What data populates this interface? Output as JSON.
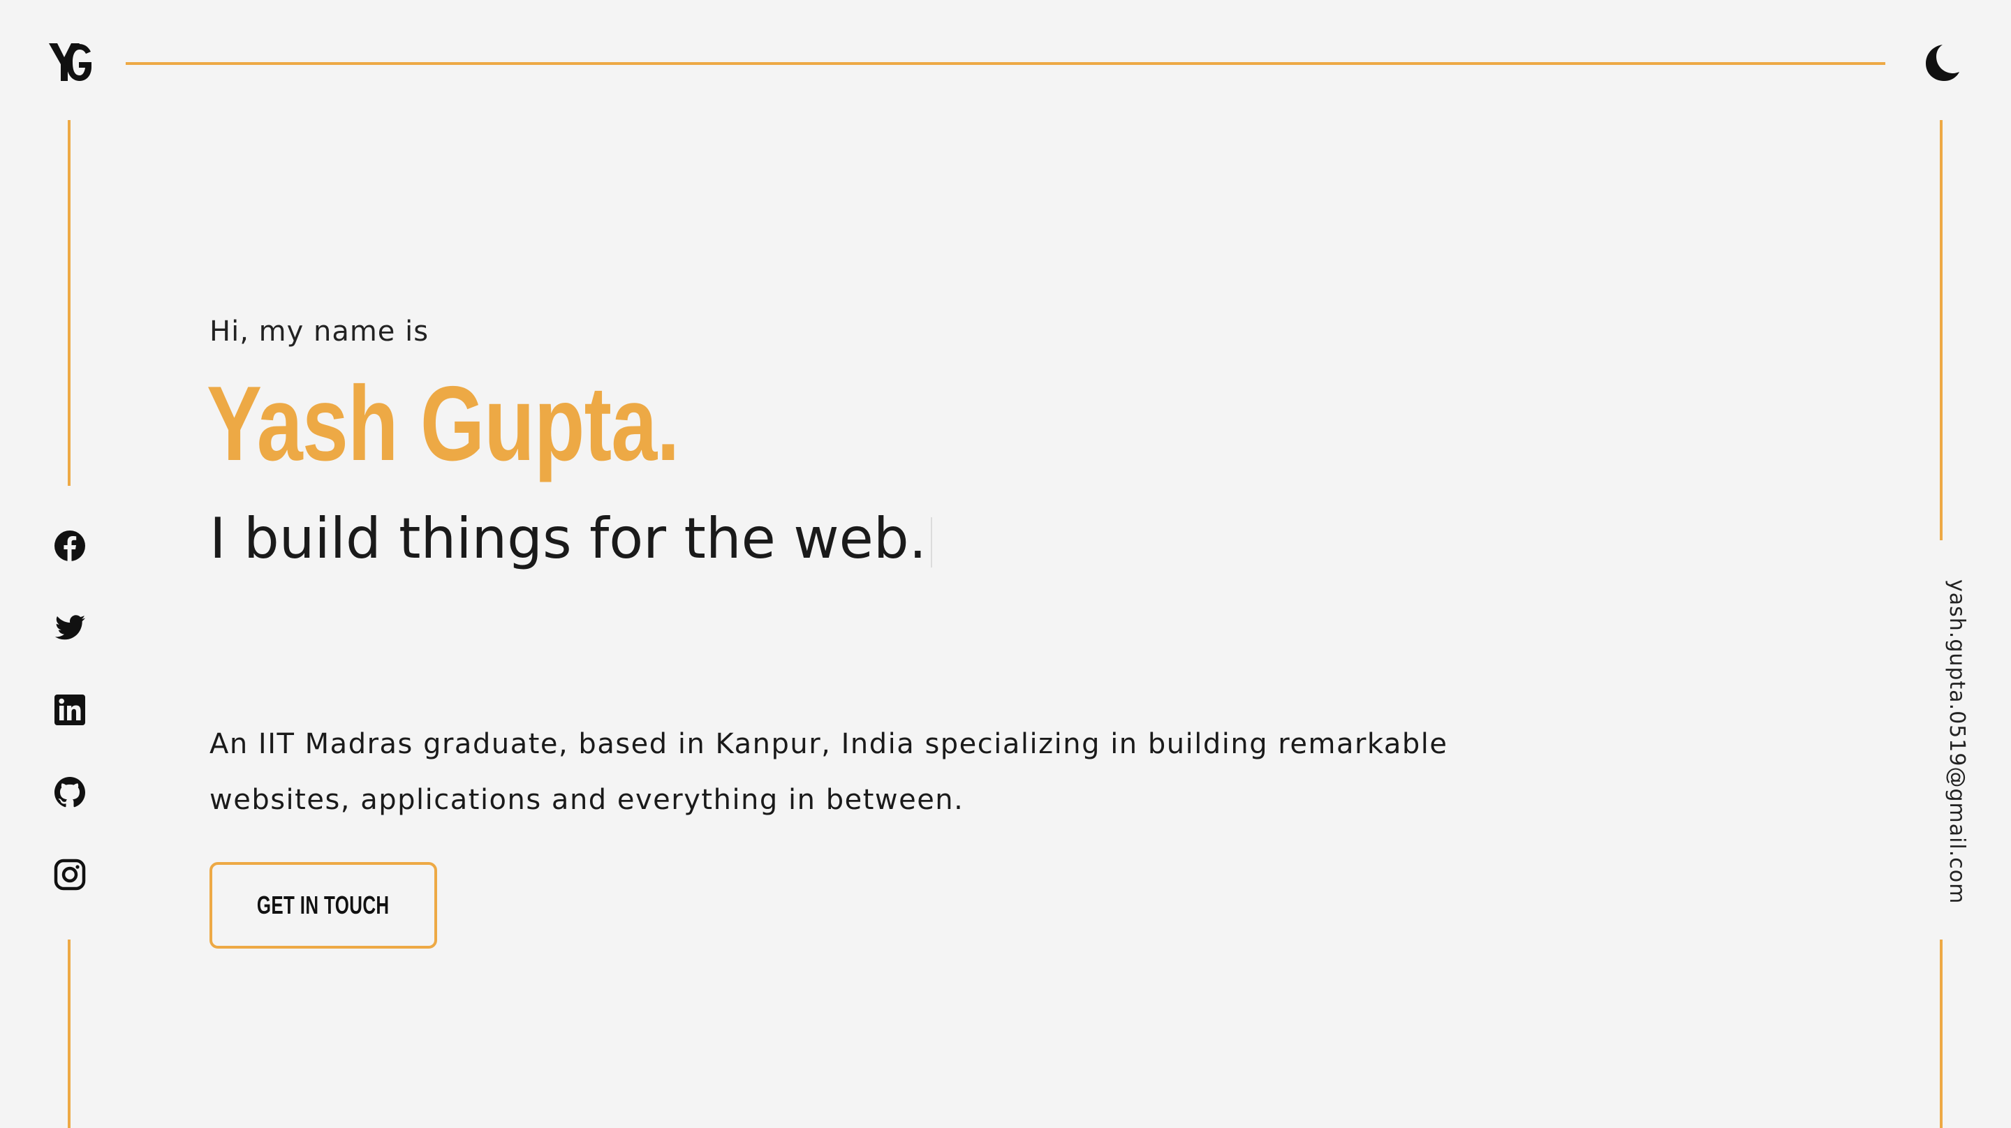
{
  "brand": {
    "logo_text": "YG",
    "accent_color": "#eda945",
    "text_color": "#1a1a1a",
    "background_color": "#f4f4f4"
  },
  "header": {
    "theme_toggle_icon": "moon-icon"
  },
  "social_links": [
    {
      "name": "facebook",
      "icon": "facebook-icon"
    },
    {
      "name": "twitter",
      "icon": "twitter-icon"
    },
    {
      "name": "linkedin",
      "icon": "linkedin-icon"
    },
    {
      "name": "github",
      "icon": "github-icon"
    },
    {
      "name": "instagram",
      "icon": "instagram-icon"
    }
  ],
  "contact": {
    "email": "yash.gupta.0519@gmail.com"
  },
  "hero": {
    "greeting": "Hi, my name is",
    "name": "Yash Gupta.",
    "tagline": "I build things for the web.",
    "description": "An IIT Madras graduate, based in Kanpur, India specializing in building remarkable websites, applications and everything in between.",
    "cta_label": "GET IN TOUCH"
  }
}
